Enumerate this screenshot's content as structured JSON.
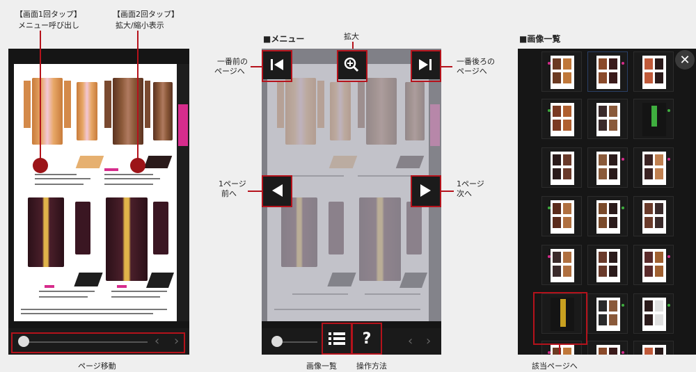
{
  "annotations": {
    "tap1_line1": "【画面1回タップ】",
    "tap1_line2": "メニュー呼び出し",
    "tap2_line1": "【画面2回タップ】",
    "tap2_line2": "拡大/縮小表示",
    "page_move": "ページ移動",
    "menu_title": "■メニュー",
    "zoom": "拡大",
    "first_page_line1": "一番前の",
    "first_page_line2": "ページへ",
    "last_page_line1": "一番後ろの",
    "last_page_line2": "ページへ",
    "prev_page_line1": "1ページ",
    "prev_page_line2": "前へ",
    "next_page_line1": "1ページ",
    "next_page_line2": "次へ",
    "image_list_btn": "画像一覧",
    "howto_btn": "操作方法",
    "thumb_title": "■画像一覧",
    "goto_page": "該当ページへ"
  },
  "icons": {
    "first": "skip-first-icon",
    "last": "skip-last-icon",
    "zoom": "zoom-in-icon",
    "prev": "triangle-left-icon",
    "next": "triangle-right-icon",
    "list": "list-icon",
    "help": "question-icon",
    "close": "close-icon"
  },
  "colors": {
    "annotation_red": "#b5121b",
    "accent_pink": "#d62c8c",
    "viewer_dark": "#151515"
  }
}
